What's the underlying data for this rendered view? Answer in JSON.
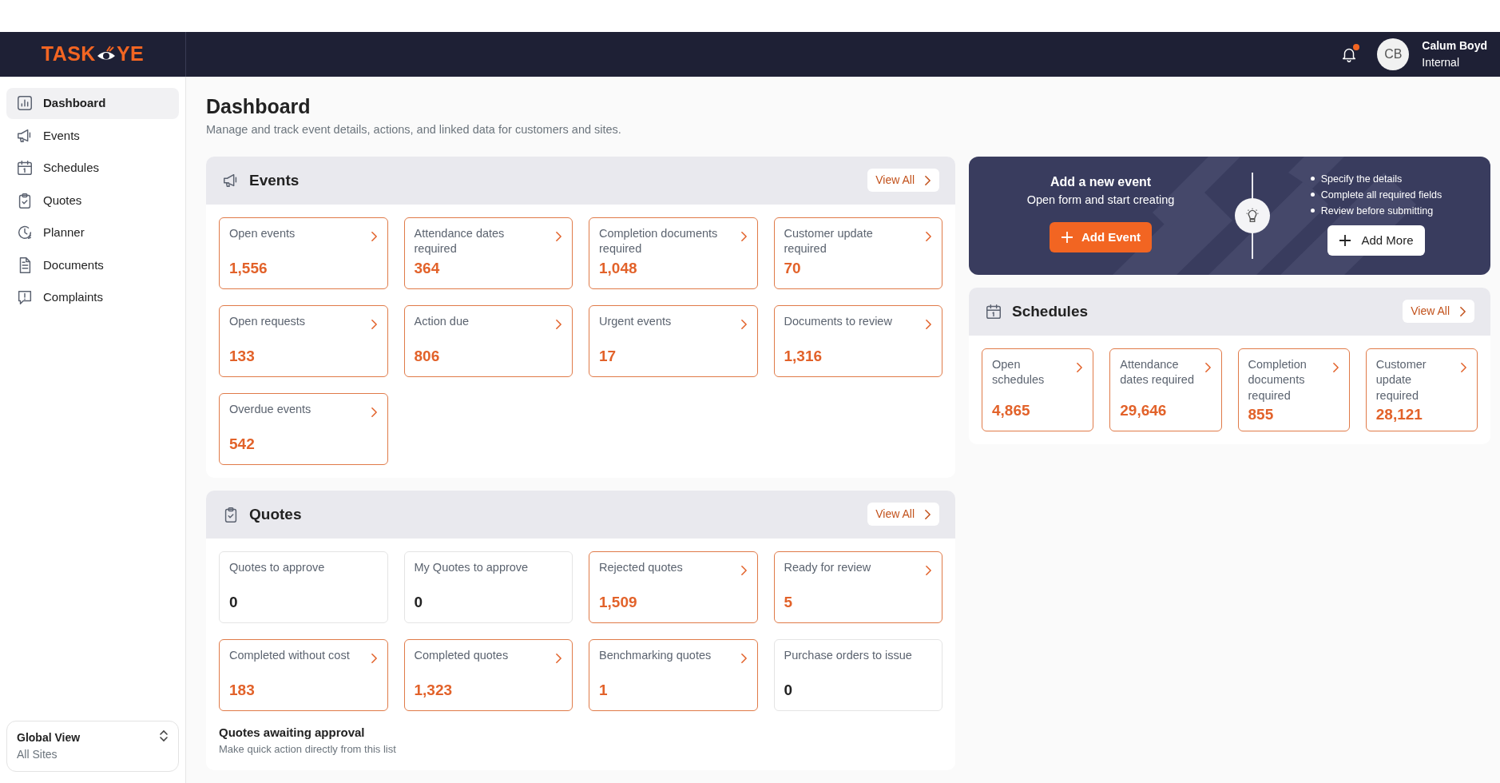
{
  "logo": {
    "left": "TASK",
    "right": "YE"
  },
  "user": {
    "initials": "CB",
    "name": "Calum Boyd",
    "role": "Internal",
    "has_notifications": true
  },
  "sidebar": {
    "items": [
      {
        "label": "Dashboard",
        "selected": true
      },
      {
        "label": "Events",
        "selected": false
      },
      {
        "label": "Schedules",
        "selected": false
      },
      {
        "label": "Quotes",
        "selected": false
      },
      {
        "label": "Planner",
        "selected": false
      },
      {
        "label": "Documents",
        "selected": false
      },
      {
        "label": "Complaints",
        "selected": false
      }
    ],
    "scope": {
      "title": "Global View",
      "subtitle": "All Sites"
    }
  },
  "page": {
    "title": "Dashboard",
    "subtitle": "Manage and track event details, actions, and linked data for customers and sites."
  },
  "events": {
    "title": "Events",
    "view_all": "View All",
    "cards": [
      {
        "label": "Open events",
        "value": "1,556",
        "linked": true
      },
      {
        "label": "Attendance dates required",
        "value": "364",
        "linked": true
      },
      {
        "label": "Completion documents required",
        "value": "1,048",
        "linked": true
      },
      {
        "label": "Customer update required",
        "value": "70",
        "linked": true
      },
      {
        "label": "Open requests",
        "value": "133",
        "linked": true
      },
      {
        "label": "Action due",
        "value": "806",
        "linked": true
      },
      {
        "label": "Urgent events",
        "value": "17",
        "linked": true
      },
      {
        "label": "Documents to review",
        "value": "1,316",
        "linked": true
      },
      {
        "label": "Overdue events",
        "value": "542",
        "linked": true
      }
    ]
  },
  "promo": {
    "title": "Add a new event",
    "subtitle": "Open form and start creating",
    "primary_button": "Add Event",
    "tips": [
      "Specify the details",
      "Complete all required fields",
      "Review before submitting"
    ],
    "secondary_button": "Add More"
  },
  "schedules": {
    "title": "Schedules",
    "view_all": "View All",
    "cards": [
      {
        "label": "Open schedules",
        "value": "4,865",
        "linked": true
      },
      {
        "label": "Attendance dates required",
        "value": "29,646",
        "linked": true
      },
      {
        "label": "Completion documents required",
        "value": "855",
        "linked": true
      },
      {
        "label": "Customer update required",
        "value": "28,121",
        "linked": true
      }
    ]
  },
  "quotes": {
    "title": "Quotes",
    "view_all": "View All",
    "cards": [
      {
        "label": "Quotes to approve",
        "value": "0",
        "linked": false
      },
      {
        "label": "My Quotes to approve",
        "value": "0",
        "linked": false
      },
      {
        "label": "Rejected quotes",
        "value": "1,509",
        "linked": true
      },
      {
        "label": "Ready for review",
        "value": "5",
        "linked": true
      },
      {
        "label": "Completed without cost",
        "value": "183",
        "linked": true
      },
      {
        "label": "Completed quotes",
        "value": "1,323",
        "linked": true
      },
      {
        "label": "Benchmarking quotes",
        "value": "1",
        "linked": true
      },
      {
        "label": "Purchase orders to issue",
        "value": "0",
        "linked": false
      }
    ],
    "list_title": "Quotes awaiting approval",
    "list_subtitle": "Make quick action directly from this list"
  }
}
